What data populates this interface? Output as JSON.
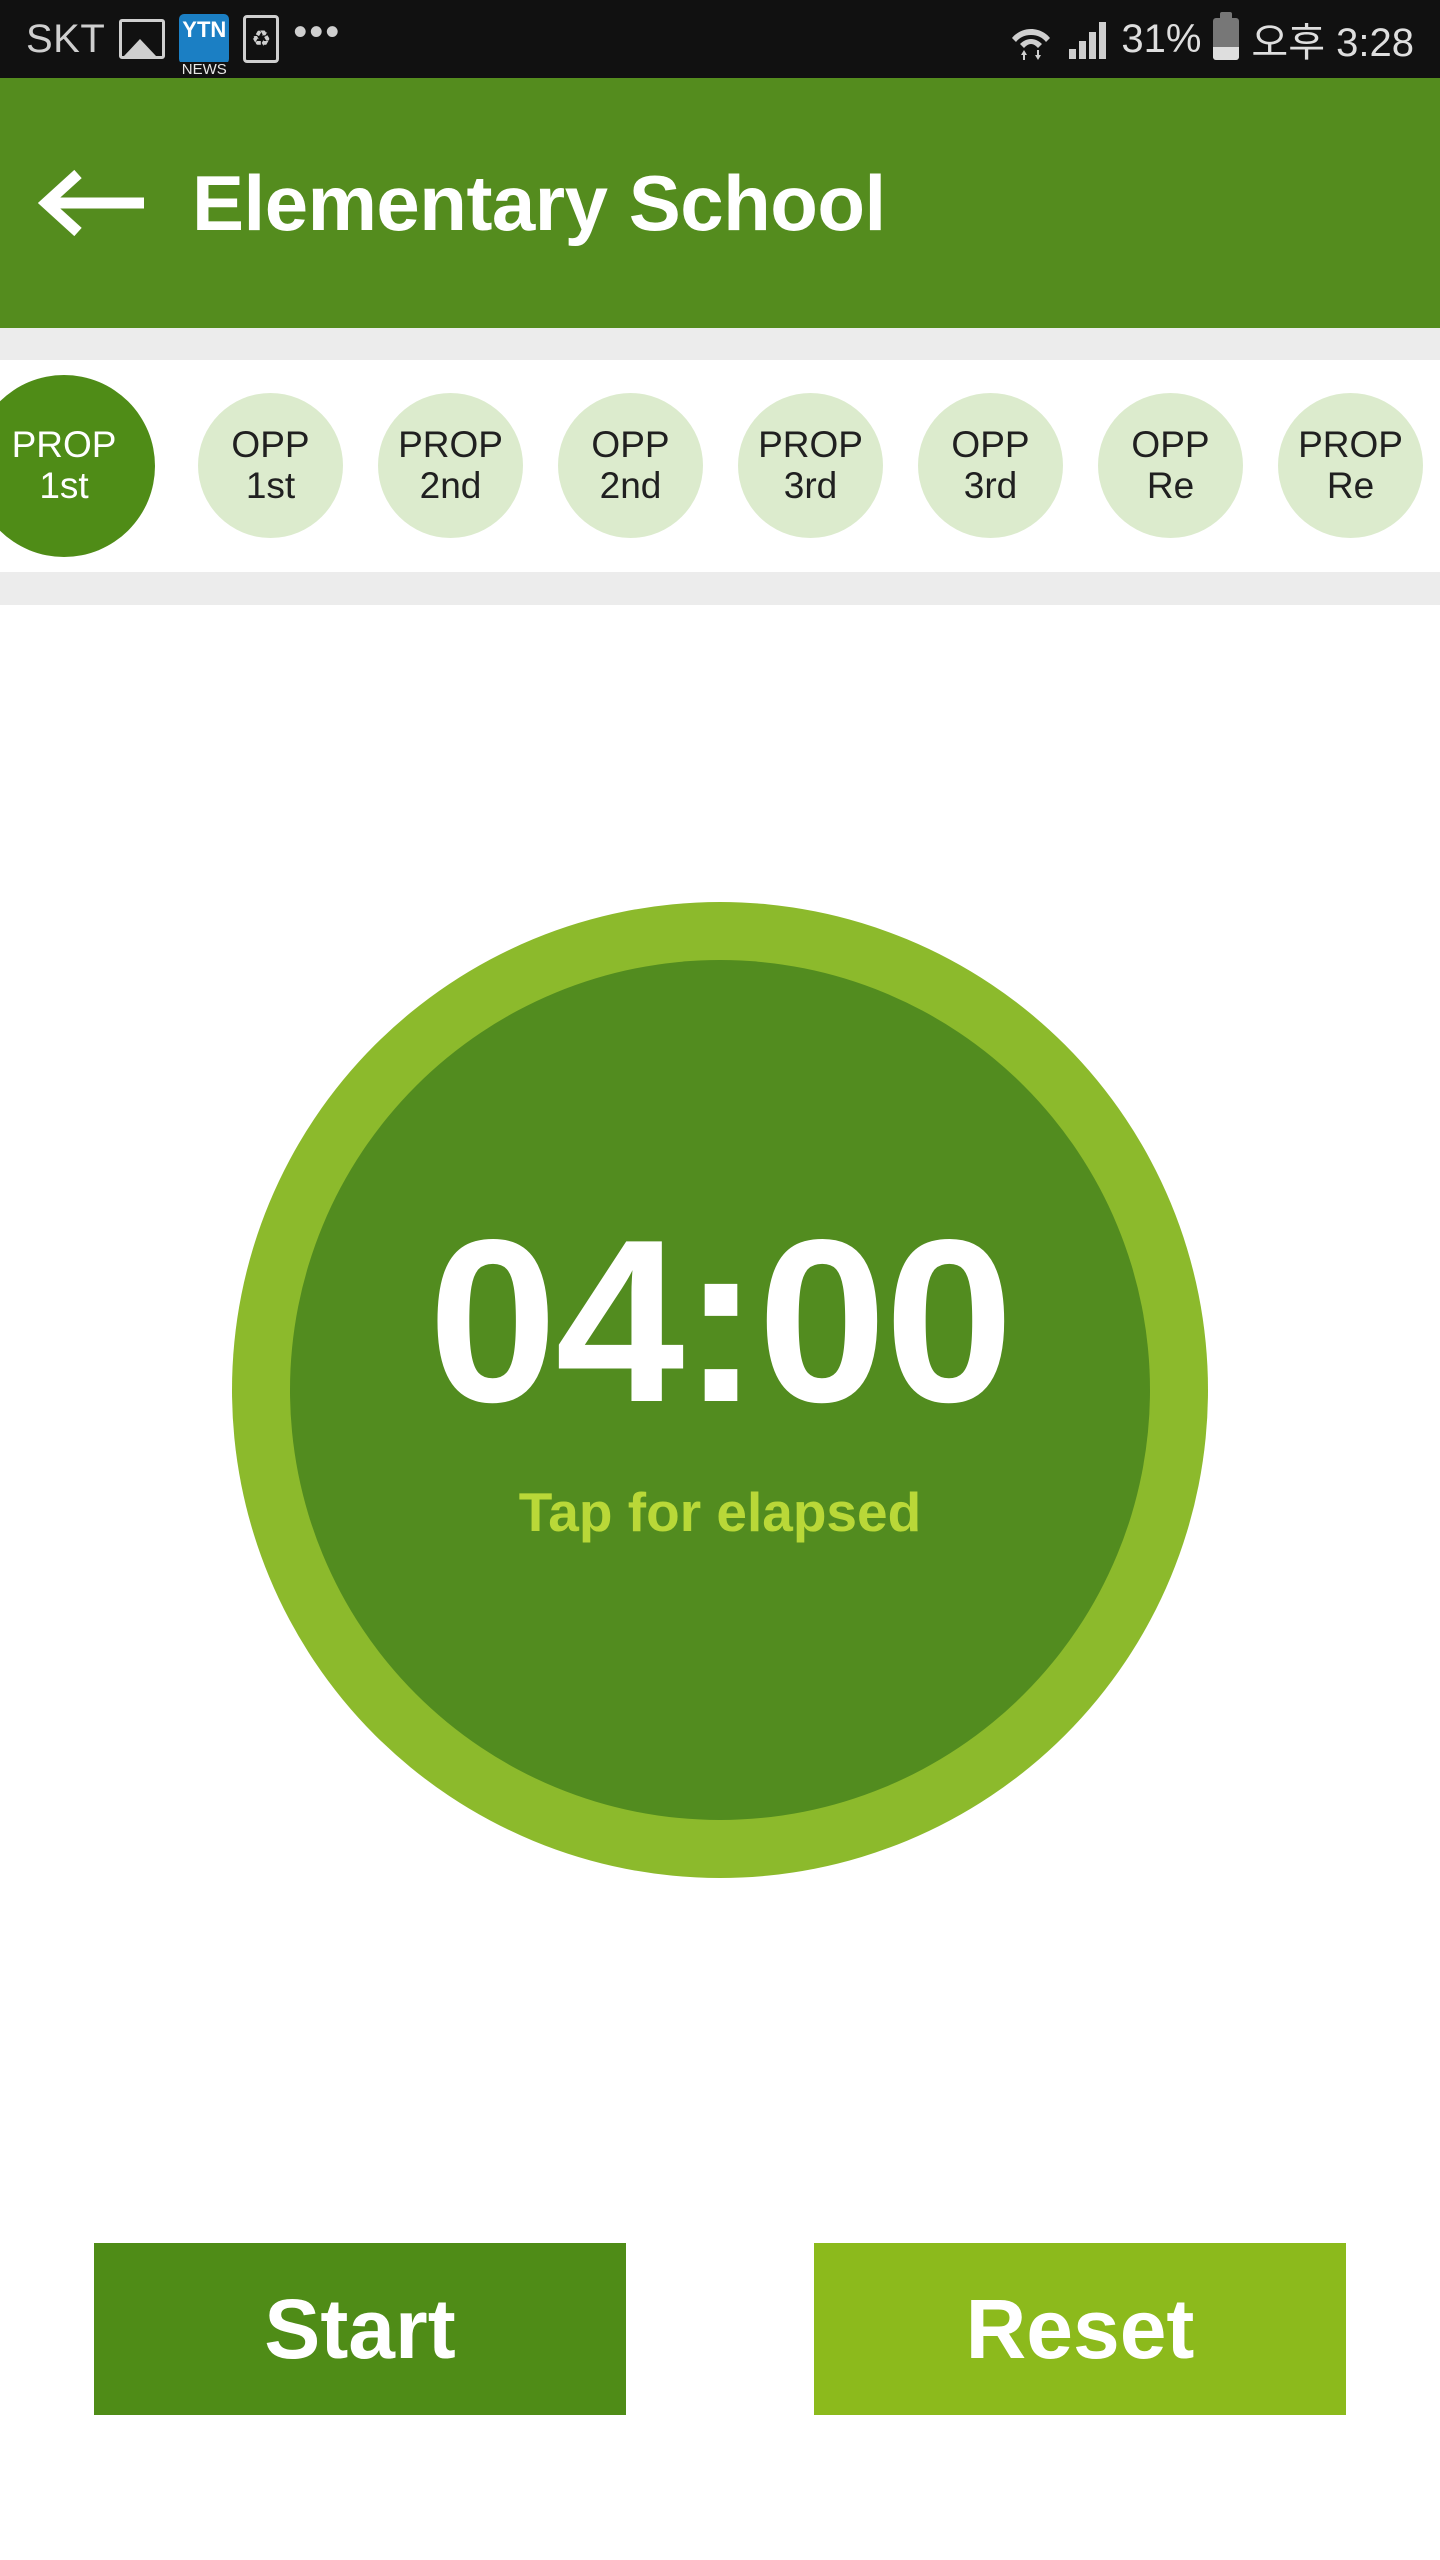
{
  "status_bar": {
    "carrier": "SKT",
    "icons": [
      "photo-icon",
      "ytn-news-icon",
      "recycle-icon",
      "more-dots-icon"
    ],
    "ytn_top": "YTN",
    "ytn_bottom": "NEWS",
    "dots": "•••",
    "battery_percent": "31%",
    "time": "오후 3:28",
    "background": "#111111"
  },
  "app_bar": {
    "back_icon": "arrow-left-icon",
    "title": "Elementary School",
    "background": "#548c1e",
    "text_color": "#ffffff"
  },
  "tabs": {
    "active_index": 0,
    "active_color": "#4f8c17",
    "inactive_color": "#dcebcd",
    "items": [
      {
        "line1": "PROP",
        "line2": "1st",
        "active": true
      },
      {
        "line1": "OPP",
        "line2": "1st",
        "active": false
      },
      {
        "line1": "PROP",
        "line2": "2nd",
        "active": false
      },
      {
        "line1": "OPP",
        "line2": "2nd",
        "active": false
      },
      {
        "line1": "PROP",
        "line2": "3rd",
        "active": false
      },
      {
        "line1": "OPP",
        "line2": "3rd",
        "active": false
      },
      {
        "line1": "OPP",
        "line2": "Re",
        "active": false
      },
      {
        "line1": "PROP",
        "line2": "Re",
        "active": false
      }
    ]
  },
  "timer": {
    "value": "04:00",
    "hint": "Tap for elapsed",
    "ring_color": "#8cba2c",
    "face_color": "#528c1f",
    "value_color": "#ffffff",
    "hint_color": "#b9d838"
  },
  "controls": {
    "start_label": "Start",
    "start_color": "#4f8c17",
    "reset_label": "Reset",
    "reset_color": "#8cba1c"
  }
}
